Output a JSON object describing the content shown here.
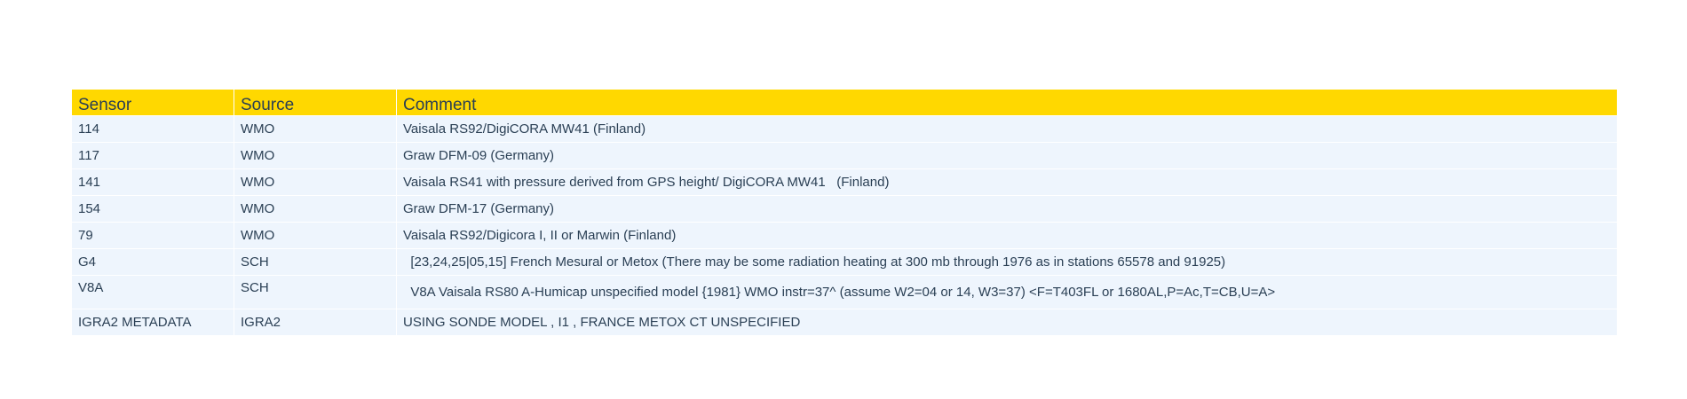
{
  "table": {
    "headers": {
      "sensor": "Sensor",
      "source": "Source",
      "comment": "Comment"
    },
    "rows": [
      {
        "sensor": "114",
        "source": "WMO",
        "comment": "Vaisala RS92/DigiCORA MW41 (Finland)"
      },
      {
        "sensor": "117",
        "source": "WMO",
        "comment": "Graw DFM-09 (Germany)"
      },
      {
        "sensor": "141",
        "source": "WMO",
        "comment": "Vaisala RS41 with pressure derived from GPS height/ DigiCORA MW41   (Finland)"
      },
      {
        "sensor": "154",
        "source": "WMO",
        "comment": "Graw DFM-17 (Germany)"
      },
      {
        "sensor": "79",
        "source": "WMO",
        "comment": "Vaisala RS92/Digicora I, II or Marwin (Finland)"
      },
      {
        "sensor": "G4",
        "source": "SCH",
        "comment": "  [23,24,25|05,15] French Mesural or Metox (There may be some radiation heating at 300 mb through 1976 as in stations 65578 and 91925)"
      },
      {
        "sensor": "V8A",
        "source": "SCH",
        "comment": "  V8A Vaisala RS80 A-Humicap unspecified model {1981} WMO instr=37^ (assume W2=04 or 14, W3=37) <F=T403FL or 1680AL,P=Ac,T=CB,U=A>"
      },
      {
        "sensor": "IGRA2 METADATA",
        "source": "IGRA2",
        "comment": "USING SONDE MODEL , I1 , FRANCE METOX CT UNSPECIFIED"
      }
    ]
  },
  "colors": {
    "header_bg": "#ffd800",
    "row_bg": "#eef5fd",
    "text": "#2a3f54"
  }
}
